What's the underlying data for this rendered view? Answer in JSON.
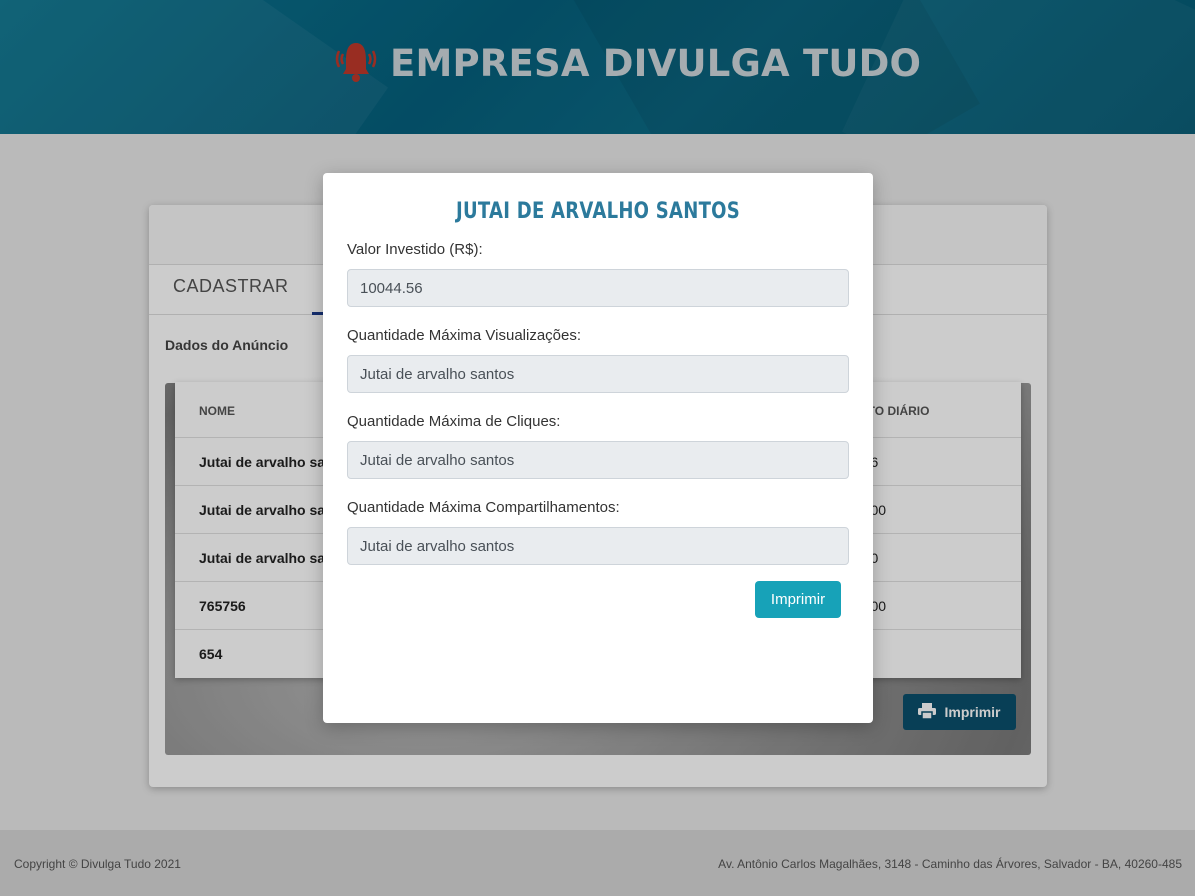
{
  "header": {
    "brand_title": "EMPRESA DIVULGA TUDO",
    "brand_icon": "alarm-bell-icon",
    "brand_icon_color": "#c0392b"
  },
  "card": {
    "tab_label": "CADASTRAR",
    "section_label": "Dados do Anúncio",
    "table": {
      "columns": [
        "NOME",
        "ENTO DIÁRIO"
      ],
      "rows": [
        {
          "name": "Jutai de arvalho san",
          "value": "4,56"
        },
        {
          "name": "Jutai de arvalho san",
          "value": "80,00"
        },
        {
          "name": "Jutai de arvalho san",
          "value": "0,00"
        },
        {
          "name": "765756",
          "value": "60,00"
        },
        {
          "name": "654",
          "value": ""
        }
      ]
    },
    "print_label": "Imprimir",
    "print_icon": "printer-icon"
  },
  "modal": {
    "title": "JUTAI DE ARVALHO SANTOS",
    "fields": [
      {
        "label": "Valor Investido (R$):",
        "value": "10044.56"
      },
      {
        "label": "Quantidade Máxima Visualizações:",
        "value": "Jutai de arvalho santos"
      },
      {
        "label": "Quantidade Máxima de Cliques:",
        "value": "Jutai de arvalho santos"
      },
      {
        "label": "Quantidade Máxima Compartilhamentos:",
        "value": "Jutai de arvalho santos"
      }
    ],
    "print_label": "Imprimir",
    "accent_color": "#17a2b8"
  },
  "footer": {
    "copyright": "Copyright © Divulga Tudo 2021",
    "address": "Av. Antônio Carlos Magalhães, 3148 - Caminho das Árvores, Salvador - BA, 40260-485"
  }
}
